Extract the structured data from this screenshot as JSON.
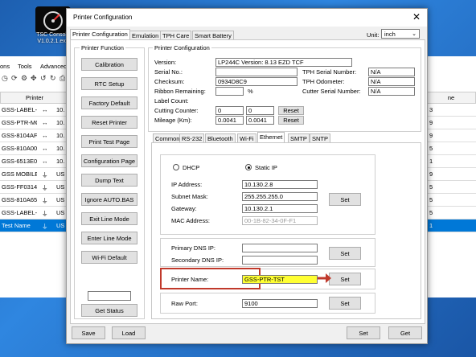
{
  "desktop": {
    "icon_label": "TSC Console V1.0.2.1.exe",
    "icon_name": "gauge-icon"
  },
  "background_app": {
    "menu": [
      "ons",
      "Tools",
      "Advanced"
    ],
    "table_header": "Printer",
    "rows": [
      {
        "name": "GSS-LABEL-P...",
        "iface": "10."
      },
      {
        "name": "GSS-PTR-MOB...",
        "iface": "10."
      },
      {
        "name": "GSS-8104AF",
        "iface": "10."
      },
      {
        "name": "GSS-810A00",
        "iface": "10."
      },
      {
        "name": "GSS-6513E0",
        "iface": "10."
      },
      {
        "name": "GSS MOBILE P...",
        "iface": "US"
      },
      {
        "name": "GSS-FF0314",
        "iface": "US"
      },
      {
        "name": "GSS-810A65",
        "iface": "US"
      },
      {
        "name": "GSS-LABEL-P...",
        "iface": "US"
      },
      {
        "name": "Test Name",
        "iface": "US"
      }
    ],
    "right_header": "ne",
    "right_rows": [
      "3",
      "9",
      "9",
      "5",
      "1",
      "9",
      "5",
      "5",
      "5",
      "1"
    ]
  },
  "dialog": {
    "title": "Printer Configuration",
    "close": "✕",
    "tabs": [
      "Printer Configuration",
      "Emulation",
      "TPH Care",
      "Smart Battery"
    ],
    "unit_label": "Unit:",
    "unit_value": "inch",
    "printer_function": {
      "label": "Printer Function",
      "buttons": [
        "Calibration",
        "RTC Setup",
        "Factory Default",
        "Reset Printer",
        "Print Test Page",
        "Configuration Page",
        "Dump Text",
        "Ignore AUTO.BAS",
        "Exit Line Mode",
        "Enter Line Mode",
        "Wi-Fi Default"
      ],
      "get_status": "Get Status"
    },
    "printer_config": {
      "label": "Printer Configuration",
      "version_label": "Version:",
      "version": "LP244C Version: 8.13 EZD TCF",
      "serial_label": "Serial No.:",
      "serial": "",
      "checksum_label": "Checksum:",
      "checksum": "0934D8C9",
      "ribbon_label": "Ribbon Remaining:",
      "ribbon": "",
      "ribbon_unit": "%",
      "label_count_label": "Label Count:",
      "cutting_label": "Cutting Counter:",
      "cutting_a": "0",
      "cutting_b": "0",
      "mileage_label": "Mileage (Km):",
      "mileage_a": "0.0041",
      "mileage_b": "0.0041",
      "reset": "Reset",
      "tph_serial_label": "TPH Serial Number:",
      "tph_serial": "N/A",
      "tph_odometer_label": "TPH Odometer:",
      "tph_odometer": "N/A",
      "cutter_serial_label": "Cutter Serial Number:",
      "cutter_serial": "N/A"
    },
    "sub_tabs": [
      "Common",
      "RS-232",
      "Bluetooth",
      "Wi-Fi",
      "Ethernet",
      "SMTP",
      "SNTP"
    ],
    "ethernet": {
      "dhcp": "DHCP",
      "static": "Static IP",
      "ip_label": "IP Address:",
      "ip": "10.130.2.8",
      "subnet_label": "Subnet Mask:",
      "subnet": "255.255.255.0",
      "gateway_label": "Gateway:",
      "gateway": "10.130.2.1",
      "mac_label": "MAC Address:",
      "mac": "00-1B-82-34-0F-F1",
      "primary_dns_label": "Primary DNS IP:",
      "primary_dns": "",
      "secondary_dns_label": "Secondary DNS IP:",
      "secondary_dns": "",
      "printer_name_label": "Printer Name:",
      "printer_name": "GSS-PTR-TST",
      "raw_port_label": "Raw Port:",
      "raw_port": "9100",
      "set": "Set"
    },
    "footer": {
      "save": "Save",
      "load": "Load",
      "set": "Set",
      "get": "Get"
    }
  },
  "colors": {
    "highlight": "#c0392b",
    "name_field": "#ffff33",
    "selection": "#0078d7"
  }
}
